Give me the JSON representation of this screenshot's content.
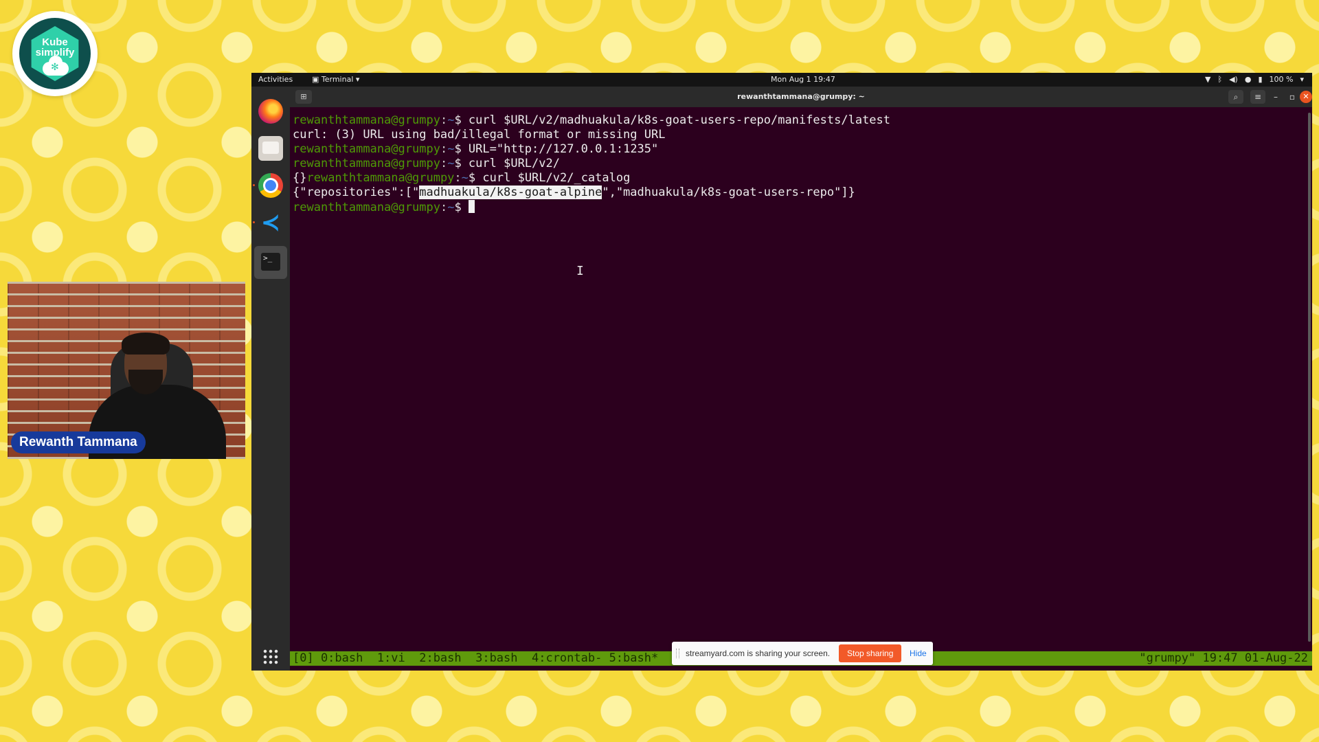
{
  "logo": {
    "text_line1": "Kube",
    "text_line2": "simplify"
  },
  "webcam": {
    "presenter_name": "Rewanth Tammana"
  },
  "topbar": {
    "activities": "Activities",
    "app_menu": "Terminal ▾",
    "clock": "Mon Aug 1  19:47",
    "battery": "100 %"
  },
  "window": {
    "title": "rewanthtammana@grumpy: ~"
  },
  "terminal": {
    "prompt_user": "rewanthtammana@grumpy",
    "prompt_sep": ":",
    "prompt_path": "~",
    "prompt_dollar": "$ ",
    "lines": [
      {
        "pre": "",
        "cmd": "curl $URL/v2/madhuakula/k8s-goat-users-repo/manifests/latest"
      },
      {
        "output": "curl: (3) URL using bad/illegal format or missing URL"
      },
      {
        "pre": "",
        "cmd": "URL=\"http://127.0.0.1:1235\""
      },
      {
        "pre": "",
        "cmd": "curl $URL/v2/"
      },
      {
        "pre": "{}",
        "cmd": "curl $URL/v2/_catalog"
      },
      {
        "output_a": "{\"repositories\":[\"",
        "output_hl": "madhuakula/k8s-goat-alpine",
        "output_b": "\",\"madhuakula/k8s-goat-users-repo\"]}"
      },
      {
        "pre": "",
        "cmd": ""
      }
    ]
  },
  "tmux": {
    "left": "[0] 0:bash  1:vi  2:bash  3:bash  4:crontab- 5:bash*",
    "right": "\"grumpy\" 19:47 01-Aug-22"
  },
  "share_bar": {
    "message": "streamyard.com is sharing your screen.",
    "stop_label": "Stop sharing",
    "hide_label": "Hide"
  },
  "colors": {
    "background": "#f6d93a",
    "terminal_bg": "#2c001e",
    "prompt_user": "#4e9a06",
    "tmux_bar": "#5f9a0c",
    "stop_button": "#f25a29",
    "name_tag": "#173a9b"
  }
}
